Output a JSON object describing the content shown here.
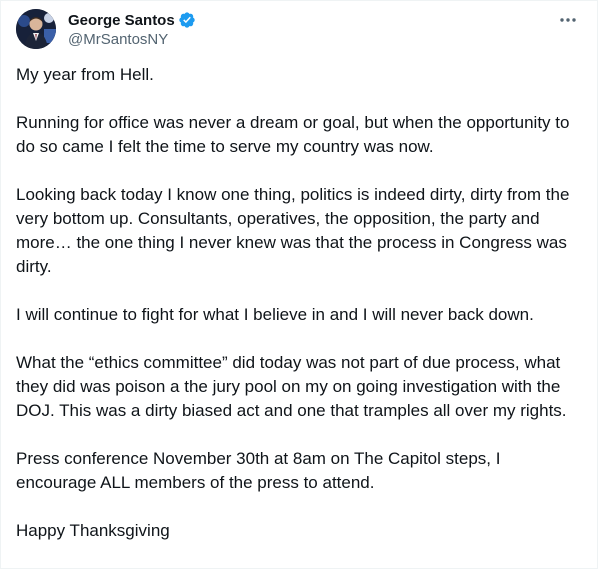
{
  "author": {
    "display_name": "George Santos",
    "handle": "@MrSantosNY",
    "verified": true,
    "verified_color": "#1d9bf0"
  },
  "icons": {
    "verified": "verified-badge-icon",
    "more": "more-options-icon"
  },
  "tweet": {
    "paragraphs": [
      "My year from Hell.",
      "Running for office was never a dream or goal, but when the opportunity to do so came I felt the time to serve my country was now.",
      "Looking back today I know one thing, politics is indeed dirty, dirty from the very bottom up. Consultants, operatives, the opposition, the party and more… the one thing I never knew was that the process in Congress was dirty.",
      "I will continue to fight for what I believe in and I will never back down.",
      "What the “ethics committee” did today was not part of due process, what they did was poison a the jury pool on my on going investigation with the DOJ. This was a dirty biased act and one that tramples all over my rights.",
      "Press conference November 30th at 8am on The Capitol steps, I encourage ALL members of the press to attend.",
      "Happy Thanksgiving"
    ]
  },
  "colors": {
    "text": "#0f1419",
    "secondary_text": "#536471",
    "border": "#eff3f4"
  }
}
